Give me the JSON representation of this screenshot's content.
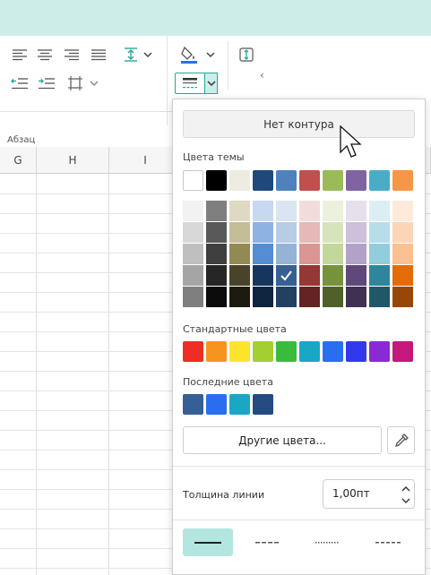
{
  "ribbon": {
    "group_label": "Абзац",
    "collapse_arrow": "‹"
  },
  "columns": [
    "G",
    "H",
    "I"
  ],
  "panel": {
    "no_outline": "Нет контура",
    "theme_colors_label": "Цвета темы",
    "theme_colors": [
      "#ffffff",
      "#000000",
      "#eeece1",
      "#1f497d",
      "#4f81bd",
      "#c0504d",
      "#9bbb59",
      "#8064a2",
      "#4bacc6",
      "#f79646"
    ],
    "theme_shades": [
      [
        "#f2f2f2",
        "#7f7f7f",
        "#ddd9c3",
        "#c6d9f0",
        "#dbe5f1",
        "#f2dcdb",
        "#ebf1dd",
        "#e5e0ec",
        "#dbeef3",
        "#fdeada"
      ],
      [
        "#d8d8d8",
        "#595959",
        "#c4bd97",
        "#8db3e2",
        "#b8cce4",
        "#e5b9b7",
        "#d7e3bc",
        "#ccc1d9",
        "#b7dde8",
        "#fbd5b5"
      ],
      [
        "#bfbfbf",
        "#3f3f3f",
        "#938953",
        "#548dd4",
        "#95b3d7",
        "#d99694",
        "#c3d69b",
        "#b2a2c7",
        "#92cddc",
        "#fac08f"
      ],
      [
        "#a5a5a5",
        "#262626",
        "#494429",
        "#17365d",
        "#366092",
        "#953734",
        "#76923c",
        "#5f497a",
        "#31859b",
        "#e36c09"
      ],
      [
        "#7f7f7f",
        "#0c0c0c",
        "#1d1b10",
        "#0f243e",
        "#244061",
        "#632423",
        "#4f6128",
        "#3f3151",
        "#205867",
        "#974806"
      ]
    ],
    "selected_shade": "#366092",
    "standard_colors_label": "Стандартные цвета",
    "standard_colors": [
      "#ee2e24",
      "#f7941d",
      "#fde42c",
      "#a4cf31",
      "#3bbb3d",
      "#1aa7c5",
      "#2a6ef0",
      "#3238ee",
      "#8a2ad5",
      "#c4187a"
    ],
    "recent_colors_label": "Последние цвета",
    "recent_colors": [
      "#355f95",
      "#2a6ef0",
      "#1aa7c5",
      "#244a82"
    ],
    "other_colors_button": "Другие цвета...",
    "line_width_label": "Толщина линии",
    "line_width_value": "1,00пт",
    "dash_styles": [
      "solid",
      "dash",
      "dot",
      "dash-dot"
    ],
    "selected_dash": "solid"
  },
  "colors": {
    "accent": "#26a69a",
    "topbar": "#cdeee8",
    "selection": "#b3e6df"
  }
}
